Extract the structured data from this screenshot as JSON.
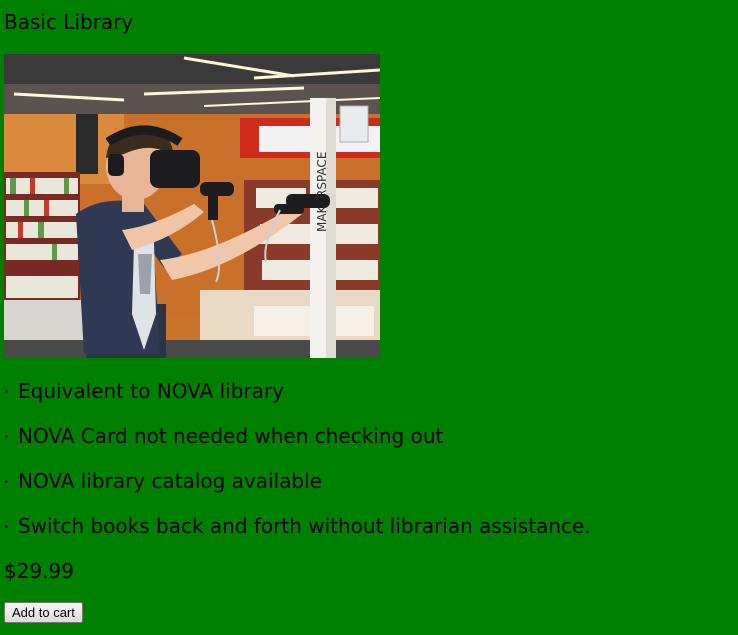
{
  "product": {
    "title": "Basic Library",
    "image_alt": "Person using a VR headset in a library makerspace",
    "signage_text": "MAKERSPACE",
    "features": [
      "Equivalent to NOVA library",
      "NOVA Card not needed when checking out",
      "NOVA library catalog available",
      "Switch books back and forth without librarian assistance."
    ],
    "bullet_glyph": "‣",
    "price": "$29.99",
    "add_to_cart_label": "Add to cart"
  },
  "colors": {
    "page_background": "#008000"
  }
}
